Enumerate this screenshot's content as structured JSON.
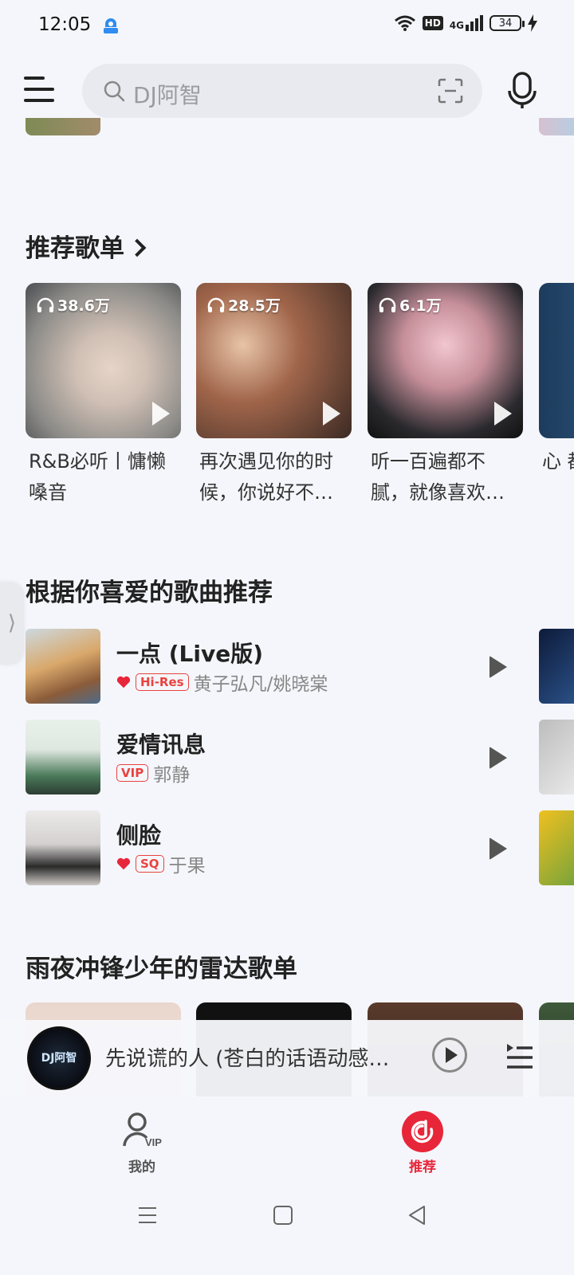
{
  "status_bar": {
    "time": "12:05",
    "battery": "34",
    "network": "4G",
    "hd": "HD",
    "icons": [
      "app-icon",
      "wifi-icon",
      "hd-icon",
      "signal-icon",
      "battery-icon",
      "charging-icon"
    ]
  },
  "search": {
    "placeholder": "DJ阿智"
  },
  "recommended_playlists": {
    "title": "推荐歌单",
    "items": [
      {
        "count": "38.6万",
        "title": "R&B必听丨慵懒嗓音"
      },
      {
        "count": "28.5万",
        "title": "再次遇见你的时候，你说好不…"
      },
      {
        "count": "6.1万",
        "title": "听一百遍都不腻，就像喜欢…"
      },
      {
        "count": "",
        "title": "心 都"
      }
    ]
  },
  "liked_recommend": {
    "title": "根据你喜爱的歌曲推荐",
    "songs": [
      {
        "title": "一点 (Live版)",
        "liked": true,
        "tag": "Hi-Res",
        "artist": "黄子弘凡/姚晓棠"
      },
      {
        "title": "爱情讯息",
        "liked": false,
        "tag": "VIP",
        "artist": "郭静"
      },
      {
        "title": "侧脸",
        "liked": true,
        "tag": "SQ",
        "artist": "于果"
      }
    ]
  },
  "radar": {
    "title": "雨夜冲锋少年的雷达歌单"
  },
  "mini_player": {
    "title": "先说谎的人 (苍白的话语动感…",
    "disc_label": "DJ阿智"
  },
  "bottom_nav": {
    "items": [
      {
        "label": "我的",
        "badge": "VIP"
      },
      {
        "label": "推荐"
      }
    ]
  },
  "colors": {
    "accent": "#e8263a",
    "tag_red": "#e8433f",
    "background": "#f5f6fb"
  }
}
